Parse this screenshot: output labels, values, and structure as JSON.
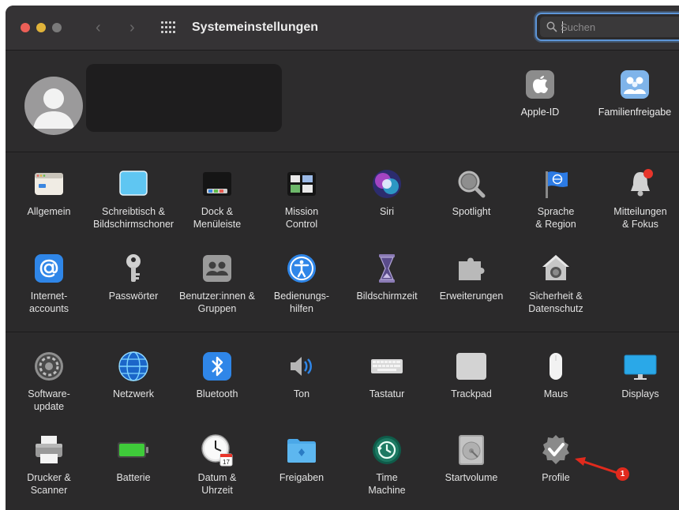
{
  "window": {
    "title": "Systemeinstellungen"
  },
  "titlebar": {
    "back_glyph": "‹",
    "forward_glyph": "›",
    "grid_icon": "grid-icon"
  },
  "search": {
    "placeholder": "Suchen",
    "value": ""
  },
  "account": {
    "items": [
      {
        "label": "Apple-ID",
        "icon": "apple-icon"
      },
      {
        "label": "Familienfreigabe",
        "icon": "family-icon"
      }
    ]
  },
  "sections": [
    {
      "items": [
        {
          "label": "Allgemein",
          "icon": "general-icon"
        },
        {
          "label": "Schreibtisch &\nBildschirmschoner",
          "icon": "desktop-icon"
        },
        {
          "label": "Dock &\nMenüleiste",
          "icon": "dock-icon"
        },
        {
          "label": "Mission\nControl",
          "icon": "mission-control-icon"
        },
        {
          "label": "Siri",
          "icon": "siri-icon"
        },
        {
          "label": "Spotlight",
          "icon": "spotlight-icon"
        },
        {
          "label": "Sprache\n& Region",
          "icon": "language-icon"
        },
        {
          "label": "Mitteilungen\n& Fokus",
          "icon": "notifications-icon"
        }
      ]
    },
    {
      "items": [
        {
          "label": "Internet-\naccounts",
          "icon": "at-icon"
        },
        {
          "label": "Passwörter",
          "icon": "key-icon"
        },
        {
          "label": "Benutzer:innen &\nGruppen",
          "icon": "users-icon"
        },
        {
          "label": "Bedienungs-\nhilfen",
          "icon": "accessibility-icon"
        },
        {
          "label": "Bildschirmzeit",
          "icon": "hourglass-icon"
        },
        {
          "label": "Erweiterungen",
          "icon": "puzzle-icon"
        },
        {
          "label": "Sicherheit &\nDatenschutz",
          "icon": "house-lock-icon"
        }
      ]
    },
    {
      "items": [
        {
          "label": "Software-\nupdate",
          "icon": "gear-icon"
        },
        {
          "label": "Netzwerk",
          "icon": "globe-icon"
        },
        {
          "label": "Bluetooth",
          "icon": "bluetooth-icon"
        },
        {
          "label": "Ton",
          "icon": "speaker-icon"
        },
        {
          "label": "Tastatur",
          "icon": "keyboard-icon"
        },
        {
          "label": "Trackpad",
          "icon": "trackpad-icon"
        },
        {
          "label": "Maus",
          "icon": "mouse-icon"
        },
        {
          "label": "Displays",
          "icon": "display-icon"
        }
      ]
    },
    {
      "items": [
        {
          "label": "Drucker &\nScanner",
          "icon": "printer-icon"
        },
        {
          "label": "Batterie",
          "icon": "battery-icon"
        },
        {
          "label": "Datum &\nUhrzeit",
          "icon": "clock-icon"
        },
        {
          "label": "Freigaben",
          "icon": "folder-share-icon"
        },
        {
          "label": "Time\nMachine",
          "icon": "time-machine-icon"
        },
        {
          "label": "Startvolume",
          "icon": "disk-icon"
        },
        {
          "label": "Profile",
          "icon": "profile-badge-icon"
        }
      ]
    }
  ],
  "annotation": {
    "number": "1",
    "color": "#e12a1d"
  },
  "colors": {
    "window_bg": "#2b2a2b",
    "titlebar_bg": "#353335",
    "accent": "#5d95d8",
    "close": "#ec5f57",
    "minimize": "#e0b33a",
    "zoom": "#7a7a7a"
  }
}
